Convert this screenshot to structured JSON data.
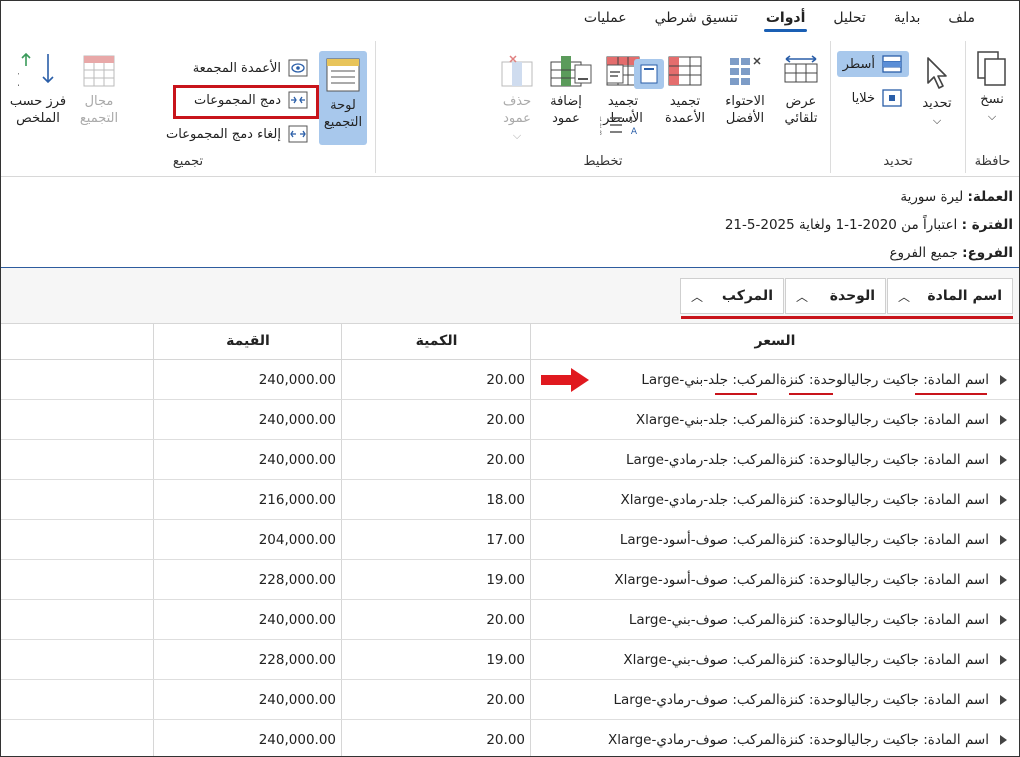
{
  "tabs": [
    "ملف",
    "بداية",
    "تحليل",
    "أدوات",
    "تنسيق شرطي",
    "عمليات"
  ],
  "ribbon": {
    "clipboard": {
      "label": "حافظة",
      "copy": "نسخ"
    },
    "select": {
      "label": "تحديد",
      "select_btn": "تحديد",
      "rows": "أسطر",
      "cells": "خلايا"
    },
    "layout": {
      "label": "تخطيط",
      "auto_fit": "عرض تلقائي",
      "best_fit": "الاحتواء الأفضل",
      "freeze_cols": "تجميد الأعمدة",
      "freeze_rows": "تجميد الأسطر",
      "add_col": "إضافة عمود",
      "del_col": "حذف عمود"
    },
    "grouping": {
      "label": "تجميع",
      "panel": "لوحة التجميع",
      "grouped_cols": "الأعمدة المجمعة",
      "merge": "دمج المجموعات",
      "unmerge": "إلغاء دمج المجموعات",
      "range": "مجال التجميع",
      "sort": "فرز حسب الملخص"
    }
  },
  "info": {
    "currency_label": "العملة:",
    "currency": "ليرة سورية",
    "period_label": "الفترة :",
    "period": "اعتباراً من 2020-1-1 ولغاية 2025-5-21",
    "branches_label": "الفروع:",
    "branches": "جميع الفروع"
  },
  "group_chips": [
    "اسم المادة",
    "الوحدة",
    "المركب"
  ],
  "columns": {
    "price": "السعر",
    "qty": "الكمية",
    "value": "القيمة"
  },
  "rows": [
    {
      "text": "اسم المادة: جاكيت رجاليالوحدة: كنزةالمركب: جلد-بني-Large",
      "qty": "20.00",
      "value": "240,000.00"
    },
    {
      "text": "اسم المادة: جاكيت رجاليالوحدة: كنزةالمركب: جلد-بني-Xlarge",
      "qty": "20.00",
      "value": "240,000.00"
    },
    {
      "text": "اسم المادة: جاكيت رجاليالوحدة: كنزةالمركب: جلد-رمادي-Large",
      "qty": "20.00",
      "value": "240,000.00"
    },
    {
      "text": "اسم المادة: جاكيت رجاليالوحدة: كنزةالمركب: جلد-رمادي-Xlarge",
      "qty": "18.00",
      "value": "216,000.00"
    },
    {
      "text": "اسم المادة: جاكيت رجاليالوحدة: كنزةالمركب: صوف-أسود-Large",
      "qty": "17.00",
      "value": "204,000.00"
    },
    {
      "text": "اسم المادة: جاكيت رجاليالوحدة: كنزةالمركب: صوف-أسود-Xlarge",
      "qty": "19.00",
      "value": "228,000.00"
    },
    {
      "text": "اسم المادة: جاكيت رجاليالوحدة: كنزةالمركب: صوف-بني-Large",
      "qty": "20.00",
      "value": "240,000.00"
    },
    {
      "text": "اسم المادة: جاكيت رجاليالوحدة: كنزةالمركب: صوف-بني-Xlarge",
      "qty": "19.00",
      "value": "228,000.00"
    },
    {
      "text": "اسم المادة: جاكيت رجاليالوحدة: كنزةالمركب: صوف-رمادي-Large",
      "qty": "20.00",
      "value": "240,000.00"
    },
    {
      "text": "اسم المادة: جاكيت رجاليالوحدة: كنزةالمركب: صوف-رمادي-Xlarge",
      "qty": "20.00",
      "value": "240,000.00"
    }
  ],
  "colors": {
    "accent": "#1a5fb4",
    "highlight": "#c8141b",
    "selected": "#a8c8ec"
  }
}
